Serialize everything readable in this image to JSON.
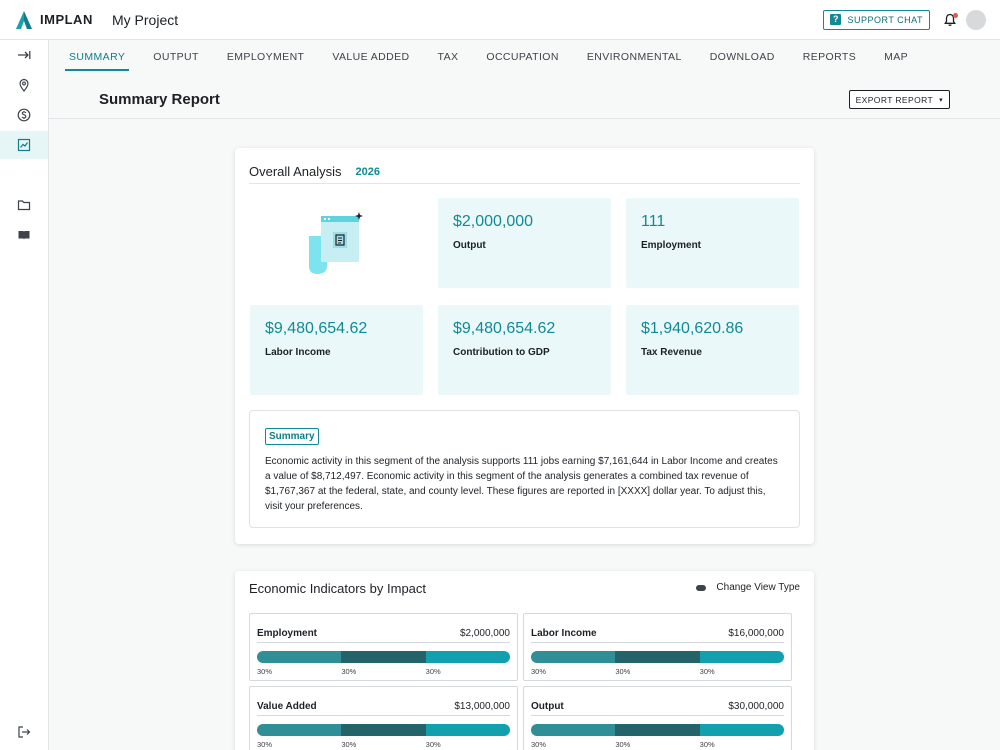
{
  "app": {
    "logo_text": "IMPLAN",
    "project_title": "My Project"
  },
  "topbar": {
    "support_label": "SUPPORT CHAT",
    "support_icon_glyph": "?"
  },
  "tabs": [
    {
      "label": "SUMMARY",
      "active": true
    },
    {
      "label": "OUTPUT"
    },
    {
      "label": "EMPLOYMENT"
    },
    {
      "label": "VALUE ADDED"
    },
    {
      "label": "TAX"
    },
    {
      "label": "OCCUPATION"
    },
    {
      "label": "ENVIRONMENTAL"
    },
    {
      "label": "DOWNLOAD"
    },
    {
      "label": "REPORTS"
    },
    {
      "label": "MAP"
    }
  ],
  "header": {
    "title": "Summary Report",
    "export_label": "EXPORT REPORT",
    "export_caret": "▾"
  },
  "overall": {
    "title": "Overall Analysis",
    "year": "2026",
    "metrics": [
      {
        "value": "$2,000,000",
        "label": "Output"
      },
      {
        "value": "111",
        "label": "Employment"
      },
      {
        "value": "$9,480,654.62",
        "label": "Labor Income"
      },
      {
        "value": "$9,480,654.62",
        "label": "Contribution to GDP"
      },
      {
        "value": "$1,940,620.86",
        "label": "Tax Revenue"
      }
    ],
    "summary_tag": "Summary",
    "summary_text": "Economic activity in this segment of the analysis supports 111 jobs earning $7,161,644 in Labor Income and creates a value of $8,712,497. Economic activity in this segment of the analysis generates a combined tax revenue of $1,767,367 at the federal, state, and county level. These figures are reported in [XXXX] dollar year. To adjust this, visit your preferences."
  },
  "indicators": {
    "title": "Economic Indicators by Impact",
    "view_type_label": "Change View Type",
    "items": [
      {
        "name": "Employment",
        "value": "$2,000,000",
        "segments": [
          30,
          30,
          30
        ],
        "segment_labels": [
          "30%",
          "30%",
          "30%"
        ]
      },
      {
        "name": "Labor Income",
        "value": "$16,000,000",
        "segments": [
          30,
          30,
          30
        ],
        "segment_labels": [
          "30%",
          "30%",
          "30%"
        ]
      },
      {
        "name": "Value Added",
        "value": "$13,000,000",
        "segments": [
          30,
          30,
          30
        ],
        "segment_labels": [
          "30%",
          "30%",
          "30%"
        ]
      },
      {
        "name": "Output",
        "value": "$30,000,000",
        "segments": [
          30,
          30,
          30
        ],
        "segment_labels": [
          "30%",
          "30%",
          "30%"
        ]
      }
    ],
    "segment_colors": [
      "#2f8e96",
      "#25636a",
      "#129fae"
    ]
  },
  "colors": {
    "accent": "#128a94",
    "metric_bg": "#eaf8fa",
    "notification_dot": "#e25b3e"
  }
}
